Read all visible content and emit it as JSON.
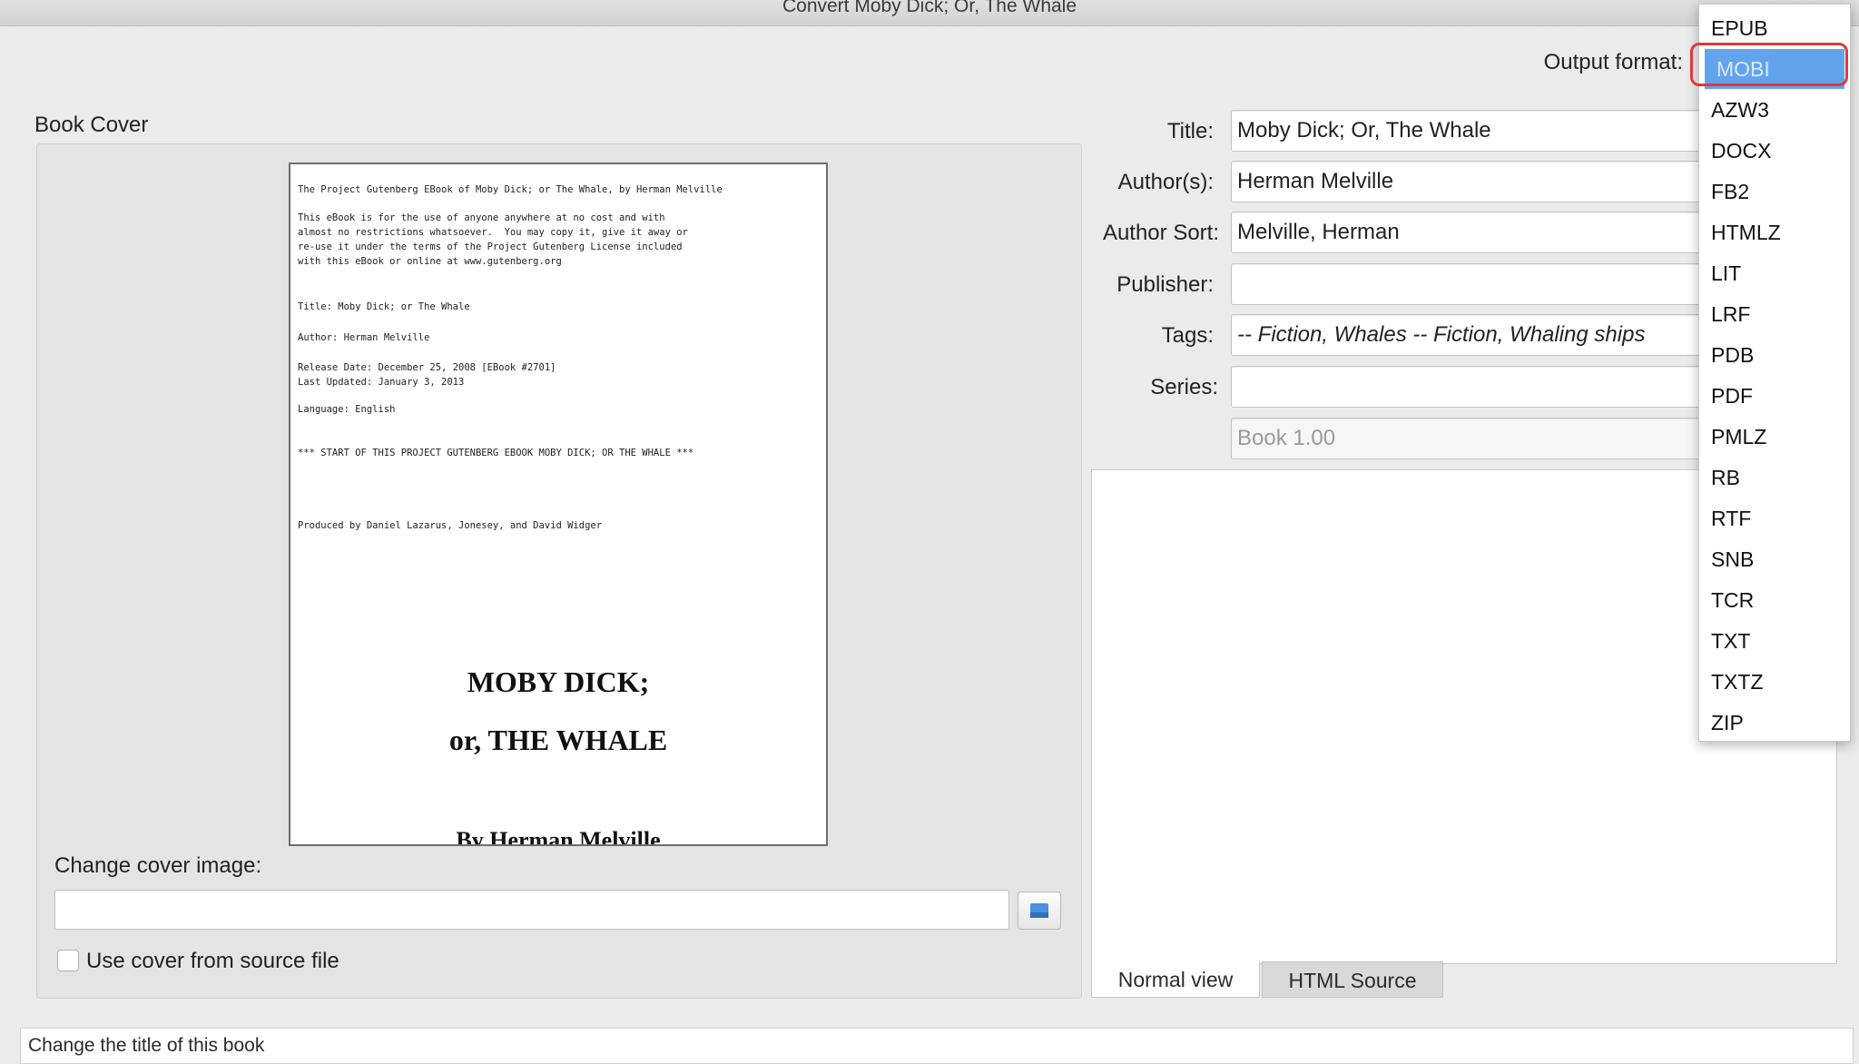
{
  "window": {
    "title": "Convert Moby Dick; Or, The Whale"
  },
  "output_format": {
    "label": "Output format:",
    "selected": "MOBI",
    "options": [
      "EPUB",
      "MOBI",
      "AZW3",
      "DOCX",
      "FB2",
      "HTMLZ",
      "LIT",
      "LRF",
      "PDB",
      "PDF",
      "PMLZ",
      "RB",
      "RTF",
      "SNB",
      "TCR",
      "TXT",
      "TXTZ",
      "ZIP"
    ]
  },
  "book_cover": {
    "heading": "Book Cover",
    "preview": {
      "line1": "The Project Gutenberg EBook of Moby Dick; or The Whale, by Herman Melville",
      "para": "This eBook is for the use of anyone anywhere at no cost and with\nalmost no restrictions whatsoever.  You may copy it, give it away or\nre-use it under the terms of the Project Gutenberg License included\nwith this eBook or online at www.gutenberg.org",
      "title_line": "Title: Moby Dick; or The Whale",
      "author_line": "Author: Herman Melville",
      "release_line": "Release Date: December 25, 2008 [EBook #2701]\nLast Updated: January 3, 2013",
      "language_line": "Language: English",
      "start_line": "*** START OF THIS PROJECT GUTENBERG EBOOK MOBY DICK; OR THE WHALE ***",
      "produced_line": "Produced by Daniel Lazarus, Jonesey, and David Widger",
      "big_title_1": "MOBY DICK;",
      "big_title_2": "or, THE WHALE",
      "big_byline": "By Herman Melville"
    },
    "change_label": "Change cover image:",
    "path_value": "",
    "use_source_label": "Use cover from source file",
    "use_source_checked": false
  },
  "metadata": {
    "title_label": "Title:",
    "title_value": "Moby Dick; Or, The Whale",
    "authors_label": "Author(s):",
    "authors_value": "Herman Melville",
    "author_sort_label": "Author Sort:",
    "author_sort_value": "Melville, Herman",
    "publisher_label": "Publisher:",
    "publisher_value": "",
    "tags_label": "Tags:",
    "tags_value": "-- Fiction, Whales -- Fiction, Whaling ships",
    "series_label": "Series:",
    "series_value": "",
    "series_index": "Book 1.00"
  },
  "comments": {
    "tab_normal": "Normal view",
    "tab_html": "HTML Source",
    "active_tab": "Normal view"
  },
  "status": {
    "text": "Change the title of this book"
  },
  "colors": {
    "selection": "#62a4ec",
    "highlight_ring": "#e0393e",
    "window_bg": "#ebebeb"
  }
}
